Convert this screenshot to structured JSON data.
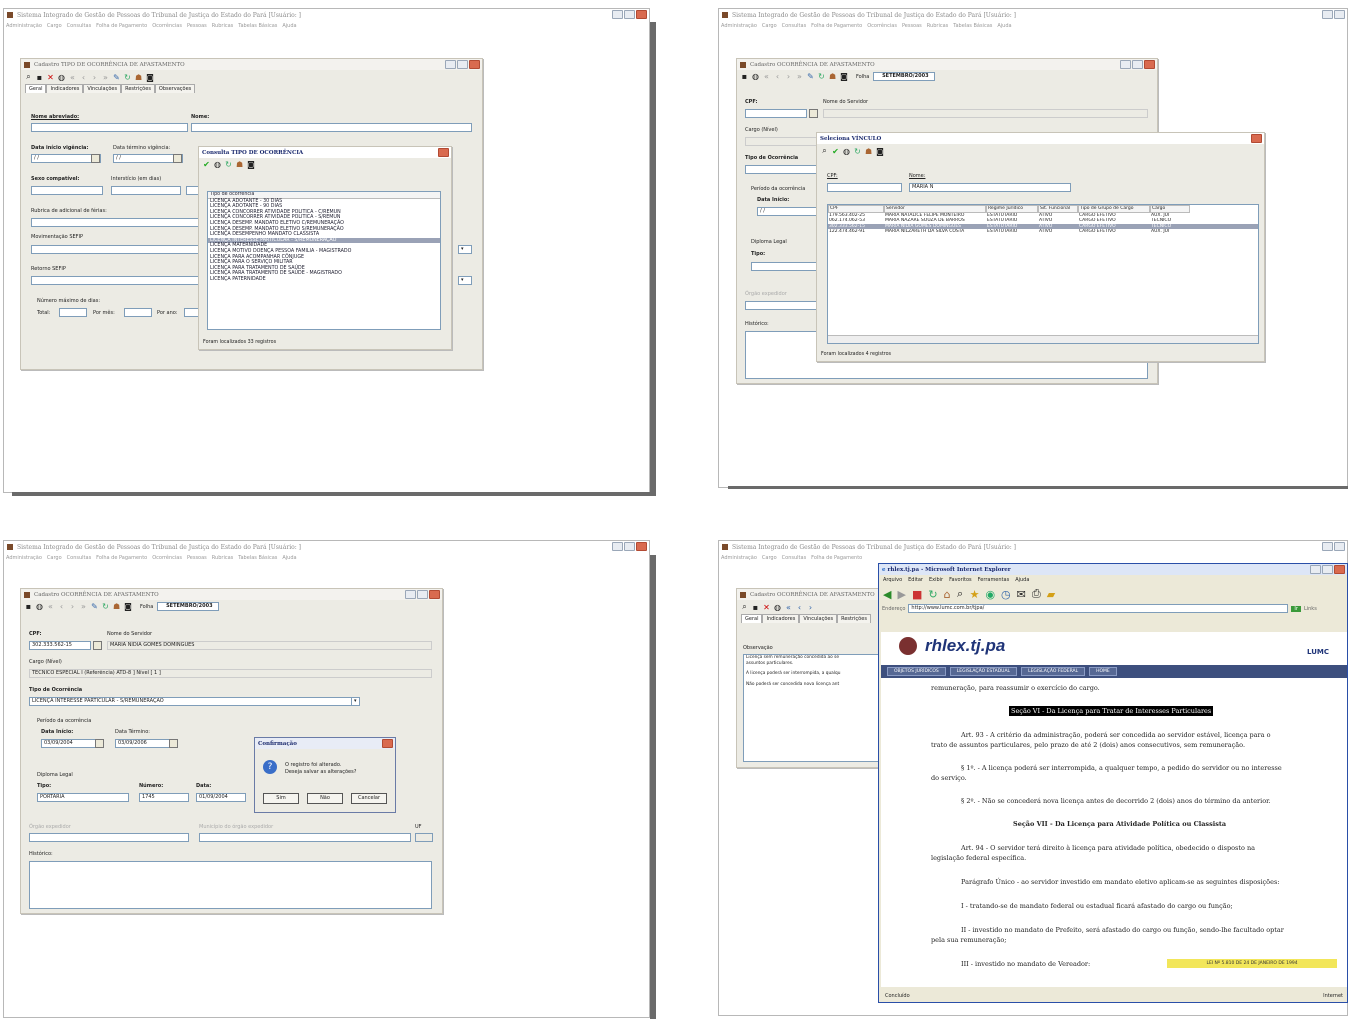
{
  "app": {
    "title": "Sistema Integrado de Gestão de Pessoas do Tribunal de Justiça do Estado do Pará [Usuário: ]",
    "menu": [
      "Administração",
      "Cargo",
      "Consultas",
      "Folha de Pagamento",
      "Ocorrências",
      "Pessoas",
      "Rubricas",
      "Tabelas Básicas",
      "Ajuda"
    ]
  },
  "p1": {
    "dialog_title": "Cadastro TIPO DE OCORRÊNCIA DE AFASTAMENTO",
    "tabs": [
      "Geral",
      "Indicadores",
      "Vinculações",
      "Restrições",
      "Observações"
    ],
    "labels": {
      "nome_abreviado": "Nome abreviado:",
      "nome": "Nome:",
      "data_inicio": "Data início vigência:",
      "data_termino": "Data término vigência:",
      "sexo": "Sexo compatível:",
      "interstico": "Interstício (em dias)",
      "rubrica": "Rubrica de adicional de férias:",
      "movimentacao": "Movimentação SEFIP",
      "retorno": "Retorno SEFIP",
      "numero_max": "Número máximo de dias:",
      "total": "Total:",
      "por_mes": "Por mês:",
      "por_ano": "Por ano:",
      "date_mask": "/ /"
    },
    "consulta": {
      "title": "Consulta TIPO DE OCORRÊNCIA",
      "column": "Tipo de ocorrência",
      "items": [
        "LICENÇA ADOTANTE - 30 DIAS",
        "LICENÇA ADOTANTE - 90 DIAS",
        "LICENÇA CONCORRER ATIVIDADE POLITICA - C/REMUN",
        "LICENÇA CONCORRER ATIVIDADE POLITICA - S/REMUN",
        "LICENÇA DESEMP. MANDATO ELETIVO C/REMUNERAÇÃO",
        "LICENÇA DESEMP. MANDATO ELETIVO S/REMUNERAÇÃO",
        "LICENÇA DESEMPENHO MANDATO CLASSISTA",
        "LICENÇA INTERESSE PARTICULAR - S/REMUNERAÇÃO",
        "LICENÇA MATERNIDADE",
        "LICENÇA MOTIVO DOENÇA PESSOA FAMILIA - MAGISTRADO",
        "LICENÇA PARA ACOMPANHAR CÔNJUGE",
        "LICENÇA PARA O SERVIÇO MILITAR",
        "LICENÇA PARA TRATAMENTO DE SAÚDE",
        "LICENÇA PARA TRATAMENTO DE SAÚDE - MAGISTRADO",
        "LICENÇA PATERNIDADE"
      ],
      "selected_index": 7,
      "status": "Foram localizados 33 registros"
    }
  },
  "p2": {
    "dialog_title": "Cadastro OCORRÊNCIA DE AFASTAMENTO",
    "folha_label": "Folha",
    "folha_value": "SETEMBRO/2003",
    "labels": {
      "cpf": "CPF:",
      "nome_servidor": "Nome do Servidor",
      "cargo": "Cargo (Nível)",
      "tipo": "Tipo de Ocorrência",
      "periodo": "Período da ocorrência",
      "data_inicio": "Data Início:",
      "diploma": "Diploma Legal",
      "tipo2": "Tipo:",
      "orgao": "Órgão expedidor",
      "historico": "Histórico:",
      "date_mask": "/ /"
    },
    "seleciona": {
      "title": "Seleciona VÍNCULO",
      "cpf_label": "CPF:",
      "nome_label": "Nome:",
      "nome_value": "MARIA N",
      "columns": [
        "CPF",
        "Servidor",
        "Regime Jurídico",
        "Sit. Funcional",
        "Tipo de Grupo de Cargo",
        "Cargo"
      ],
      "rows": [
        [
          "179.563.402-25",
          "MARIA NATALICE FELIPE MONTEIRO",
          "ESTATUTÁRIO",
          "ATIVO",
          "CARGO EFETIVO",
          "AUX. JUI"
        ],
        [
          "062.174.062-53",
          "MARIA NAZARÉ SOUZA DE BARROS",
          "ESTATUTÁRIO",
          "ATIVO",
          "CARGO EFETIVO",
          "TÉCNICO"
        ],
        [
          "302.333.562-15",
          "MARIA NIDIA GOMES DOMINGUES",
          "ESTATUTÁRIO",
          "ATIVO",
          "CARGO EFETIVO",
          "TÉCNICO"
        ],
        [
          "122.474.462-91",
          "MARIA NILZARETH DA SILVA COSTA",
          "ESTATUTÁRIO",
          "ATIVO",
          "CARGO EFETIVO",
          "AUX. JUI"
        ]
      ],
      "selected_index": 2,
      "status": "Foram localizados 4 registros"
    }
  },
  "p3": {
    "dialog_title": "Cadastro OCORRÊNCIA DE AFASTAMENTO",
    "folha_label": "Folha",
    "folha_value": "SETEMBRO/2003",
    "labels": {
      "cpf": "CPF:",
      "nome_servidor": "Nome do Servidor",
      "cargo": "Cargo (Nível)",
      "tipo": "Tipo de Ocorrência",
      "periodo": "Período da ocorrência",
      "data_inicio": "Data Início:",
      "data_termino": "Data Término:",
      "diploma": "Diploma Legal",
      "tipo2": "Tipo:",
      "numero": "Número:",
      "data": "Data:",
      "orgao": "Órgão expedidor",
      "municipio": "Município do órgão expedidor",
      "uf": "UF",
      "historico": "Histórico:"
    },
    "values": {
      "cpf": "302.333.562-15",
      "nome_servidor": "MARIA NIDIA GOMES DOMINGUES",
      "cargo": "TECNICO ESPECIAL I (Referência) ATD-8 ] Nível [ 1 ]",
      "tipo": "LICENÇA INTERESSE PARTICULAR - S/REMUNERAÇÃO",
      "data_inicio": "03/09/2004",
      "data_termino": "03/09/2006",
      "tipo2": "PORTARIA",
      "numero": "1745",
      "data": "01/09/2004"
    },
    "confirm": {
      "title": "Confirmação",
      "line1": "O registro foi alterado.",
      "line2": "Deseja salvar as alterações?",
      "yes": "Sim",
      "no": "Não",
      "cancel": "Cancelar"
    }
  },
  "p4": {
    "dialog_title": "Cadastro OCORRÊNCIA DE AFASTAMENTO",
    "tabs": [
      "Geral",
      "Indicadores",
      "Vinculações",
      "Restrições"
    ],
    "obs_label": "Observação",
    "obs_lines": [
      "Licença sem remuneração concedida ao se",
      "assuntos particulares.",
      "A licença poderá ser interrompida, a qualqu",
      "Não poderá ser concedida nova licença ant"
    ],
    "ie": {
      "title": "rhlex.tj.pa - Microsoft Internet Explorer",
      "menu": [
        "Arquivo",
        "Editar",
        "Exibir",
        "Favoritos",
        "Ferramentas",
        "Ajuda"
      ],
      "address_label": "Endereço",
      "address": "http://www.lumc.com.br/tjpa/",
      "go": "Ir",
      "links": "Links",
      "logo": "rhlex.tj.pa",
      "brand": "LUMC",
      "nav": [
        "OBJETOS JURÍDICOS",
        "LEGISLAÇÃO ESTADUAL",
        "LEGISLAÇÃO FEDERAL",
        "HOME"
      ],
      "content": {
        "intro": "remuneração, para reassumir o exercício do cargo.",
        "secao6": "Seção VI - Da Licença para Tratar de Interesses Particulares",
        "art93": "Art. 93 - A critério da administração, poderá ser concedida ao servidor estável, licença para o",
        "art93b": "trato de assuntos particulares, pelo prazo de até 2 (dois) anos consecutivos, sem remuneração.",
        "p1": "§ 1º. - A licença poderá ser interrompida, a qualquer tempo, a pedido do servidor ou no interesse",
        "p1b": "do serviço.",
        "p2": "§ 2º. - Não se concederá nova licença antes de decorrido 2 (dois) anos do término da anterior.",
        "secao7": "Seção VII - Da Licença para Atividade Política ou Classista",
        "art94": "Art. 94 - O servidor terá direito à licença para atividade política, obedecido o disposto na",
        "art94b": "legislação federal específica.",
        "paragrafo": "Parágrafo Único - ao servidor investido em mandato eletivo aplicam-se as seguintes disposições:",
        "i": "I - tratando-se de mandato federal ou estadual ficará afastado do cargo ou função;",
        "ii": "II - investido no mandato de Prefeito, será afastado do cargo ou função, sendo-lhe facultado optar",
        "iib": "pela sua remuneração;",
        "iii": "III - investido no mandato de Vereador:",
        "highlight": "LEI Nº 5.810 DE 24 DE JANEIRO DE 1994"
      },
      "status_left": "Concluído",
      "status_right": "Internet"
    }
  }
}
